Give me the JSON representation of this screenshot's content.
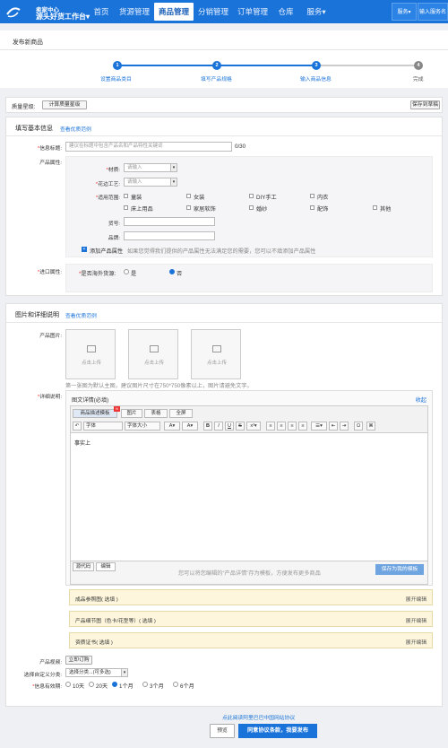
{
  "topnav": {
    "brand_line1": "卖家中心",
    "brand_line2": "源头好货工作台",
    "items": [
      "首页",
      "货源管理",
      "商品管理",
      "分销管理",
      "订单管理",
      "仓库",
      "服务"
    ],
    "right_buttons": [
      "服务",
      "输入服务名"
    ]
  },
  "page_title": "发布新商品",
  "steps": [
    {
      "num": "1",
      "label": "设置商品类目"
    },
    {
      "num": "2",
      "label": "填写产品规格"
    },
    {
      "num": "3",
      "label": "输入商品信息"
    },
    {
      "num": "4",
      "label": "完成"
    }
  ],
  "top_actions": {
    "quality_label": "质量星级:",
    "calc_button": "计算质量星级",
    "draft_button": "保存到草稿"
  },
  "basic": {
    "title": "填写基本信息",
    "example_link": "查看优质范例",
    "info_title_label": "信息标题:",
    "info_title_placeholder": "建议在标题中包含产品名和产品特性关键词",
    "info_title_count": "0/30",
    "attr_label": "产品属性:",
    "material_label": "材质:",
    "material_placeholder": "请输入",
    "craft_label": "花边工艺:",
    "craft_placeholder": "请输入",
    "scope_label": "适用范围:",
    "scope_options": [
      "童装",
      "女装",
      "DIY手工",
      "内衣",
      "床上用品",
      "家居软饰",
      "婚纱",
      "配饰",
      "其他"
    ],
    "model_label": "货号:",
    "brand_label": "品牌:",
    "add_attr": "添加产品属性",
    "add_attr_hint": "如果您觉得我们提供的产品属性无法满足您的需要，您可以不填添加产品属性",
    "import_label": "进口属性:",
    "overseas_label": "是否海外货源:",
    "overseas_yes": "是",
    "overseas_no": "否"
  },
  "images": {
    "title": "图片和详细说明",
    "example_link": "查看优质范例",
    "product_images_label": "产品图片:",
    "upload_text": "点击上传",
    "upload_hint": "第一张图为默认主图，建议图片尺寸在750*750像素以上，图片请避免文字。",
    "detail_label": "详细说明:",
    "detail_box_title": "图文详情(必填)",
    "collapse": "收起",
    "tab_template": "商品描述模板",
    "tab_image": "图片",
    "tab_table": "表格",
    "tab_fullscreen": "全屏",
    "font_select": "字体",
    "size_select": "字体大小",
    "editor_content": "事实上",
    "source_tab": "源代码",
    "edit_tab": "编辑",
    "save_template_hint": "您可以将您编辑的“产品详情”存为模板，方便发布更多商品",
    "save_template_button": "保存为我的模板"
  },
  "sections": [
    {
      "name": "成品参照图( 选填 )",
      "action": "展开编辑"
    },
    {
      "name": "产品细节图（色卡/花型等）( 选填 )",
      "action": "展开编辑"
    },
    {
      "name": "资质证书( 选填 )",
      "action": "展开编辑"
    }
  ],
  "extras": {
    "video_label": "产品视频:",
    "video_button": "立即订购",
    "category_label": "选择自定义分类:",
    "category_placeholder": "选择分类...(可多选)",
    "validity_label": "信息有效期:",
    "validity_options": [
      "10天",
      "20天",
      "1个月",
      "3个月",
      "6个月"
    ],
    "validity_selected": "1个月"
  },
  "footer": {
    "agreement_link": "点此阅读阿里巴巴中国网站协议",
    "preview_button": "预览",
    "publish_button": "同意协议条款，我要发布"
  }
}
